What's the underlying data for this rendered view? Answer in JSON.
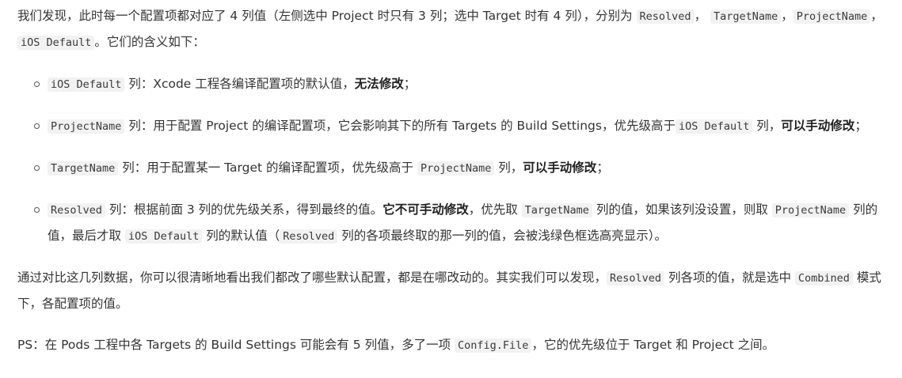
{
  "intro": {
    "t1": "我们发现，此时每一个配置项都对应了 4 列值（左侧选中 Project 时只有 3 列；选中 Target 时有 4 列），分别为 ",
    "c1": "Resolved",
    "t2": "， ",
    "c2": "TargetName",
    "t3": "，",
    "c3": "ProjectName",
    "t4": "， ",
    "c4": "iOS Default",
    "t5": "。它们的含义如下："
  },
  "items": [
    {
      "code": "iOS Default",
      "text1": " 列：Xcode 工程各编译配置项的默认值，",
      "bold1": "无法修改",
      "text2": "；"
    },
    {
      "code": "ProjectName",
      "text1": " 列：用于配置 Project 的编译配置项，它会影响其下的所有 Targets 的 Build Settings，优先级高于",
      "code2": "iOS Default",
      "text2": " 列，",
      "bold1": "可以手动修改",
      "text3": "；"
    },
    {
      "code": "TargetName",
      "text1": " 列：用于配置某一 Target 的编译配置项，优先级高于 ",
      "code2": "ProjectName",
      "text2": " 列，",
      "bold1": "可以手动修改",
      "text3": "；"
    },
    {
      "code": "Resolved",
      "text1": " 列：根据前面 3 列的优先级关系，得到最终的值。",
      "bold1": "它不可手动修改",
      "text2": "，优先取 ",
      "code2": "TargetName",
      "text3": " 列的值，如果该列没设置，则取 ",
      "code3": "ProjectName",
      "text4": " 列的值，最后才取 ",
      "code4": "iOS Default",
      "text5": " 列的默认值（",
      "code5": "Resolved",
      "text6": " 列的各项最终取的那一列的值，会被浅绿色框选高亮显示）。"
    }
  ],
  "para2": {
    "t1": "通过对比这几列数据，你可以很清晰地看出我们都改了哪些默认配置，都是在哪改动的。其实我们可以发现，",
    "c1": "Resolved",
    "t2": " 列各项的值，就是选中 ",
    "c2": "Combined",
    "t3": " 模式下，各配置项的值。"
  },
  "ps": {
    "t1": "PS：在 Pods 工程中各 Targets 的 Build Settings 可能会有 5 列值，多了一项 ",
    "c1": "Config.File",
    "t2": "，它的优先级位于 Target 和 Project 之间。"
  }
}
